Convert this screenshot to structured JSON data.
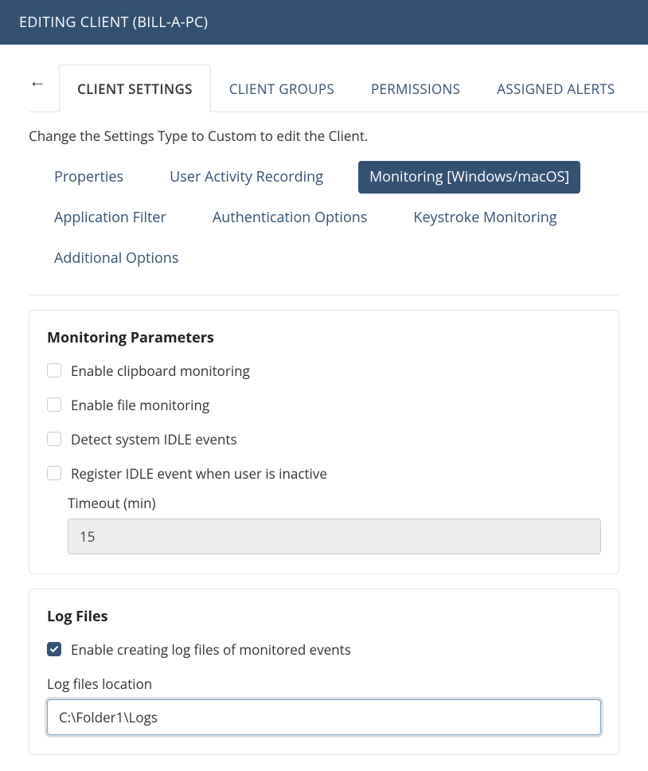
{
  "header": {
    "title": "EDITING CLIENT (BILL-A-PC)"
  },
  "topTabs": {
    "items": [
      {
        "label": "CLIENT SETTINGS",
        "active": true
      },
      {
        "label": "CLIENT GROUPS",
        "active": false
      },
      {
        "label": "PERMISSIONS",
        "active": false
      },
      {
        "label": "ASSIGNED ALERTS",
        "active": false
      }
    ]
  },
  "hint": "Change the Settings Type to Custom to edit the Client.",
  "subTabs": {
    "items": [
      {
        "label": "Properties",
        "active": false
      },
      {
        "label": "User Activity Recording",
        "active": false
      },
      {
        "label": "Monitoring [Windows/macOS]",
        "active": true
      },
      {
        "label": "Application Filter",
        "active": false
      },
      {
        "label": "Authentication Options",
        "active": false
      },
      {
        "label": "Keystroke Monitoring",
        "active": false
      },
      {
        "label": "Additional Options",
        "active": false
      }
    ]
  },
  "monitoring": {
    "heading": "Monitoring Parameters",
    "checks": {
      "clipboard": "Enable clipboard monitoring",
      "file": "Enable file monitoring",
      "idle": "Detect system IDLE events",
      "registerIdle": "Register IDLE event when user is inactive"
    },
    "timeout": {
      "label": "Timeout (min)",
      "value": "15"
    }
  },
  "logFiles": {
    "heading": "Log Files",
    "enable": "Enable creating log files of monitored events",
    "locationLabel": "Log files location",
    "locationValue": "C:\\Folder1\\Logs"
  }
}
